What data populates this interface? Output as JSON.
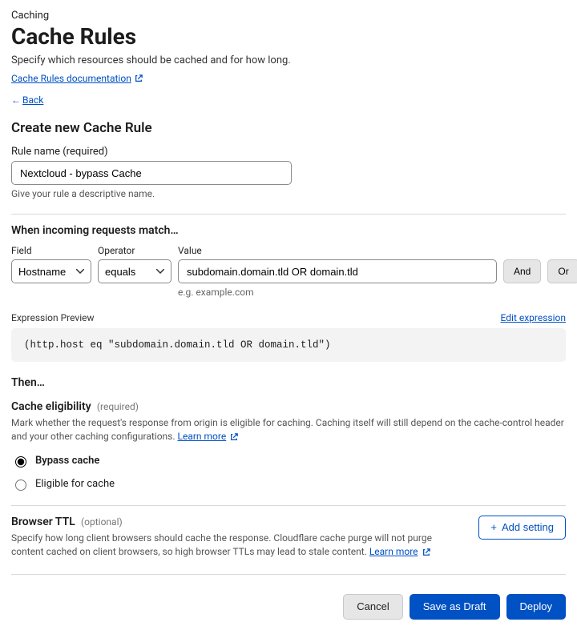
{
  "header": {
    "breadcrumb": "Caching",
    "title": "Cache Rules",
    "subtitle": "Specify which resources should be cached and for how long.",
    "doc_link": "Cache Rules documentation",
    "back": "Back"
  },
  "form": {
    "heading": "Create new Cache Rule",
    "rule_name_label": "Rule name (required)",
    "rule_name_value": "Nextcloud - bypass Cache",
    "rule_name_helper": "Give your rule a descriptive name."
  },
  "match": {
    "title": "When incoming requests match…",
    "field_label": "Field",
    "field_value": "Hostname",
    "operator_label": "Operator",
    "operator_value": "equals",
    "value_label": "Value",
    "value_value": "subdomain.domain.tld OR domain.tld",
    "value_eg": "e.g. example.com",
    "and": "And",
    "or": "Or"
  },
  "expr": {
    "label": "Expression Preview",
    "edit": "Edit expression",
    "code": "(http.host eq \"subdomain.domain.tld OR domain.tld\")"
  },
  "then": {
    "label": "Then…"
  },
  "eligibility": {
    "title": "Cache eligibility",
    "tag": "(required)",
    "desc_a": "Mark whether the request's response from origin is eligible for caching. Caching itself will still depend on the cache-control header and your other caching configurations. ",
    "learn_more": "Learn more",
    "opt_bypass": "Bypass cache",
    "opt_eligible": "Eligible for cache"
  },
  "ttl": {
    "title": "Browser TTL",
    "tag": "(optional)",
    "desc_a": "Specify how long client browsers should cache the response. Cloudflare cache purge will not purge content cached on client browsers, so high browser TTLs may lead to stale content. ",
    "learn_more": "Learn more",
    "add": "Add setting"
  },
  "footer": {
    "cancel": "Cancel",
    "draft": "Save as Draft",
    "deploy": "Deploy"
  }
}
